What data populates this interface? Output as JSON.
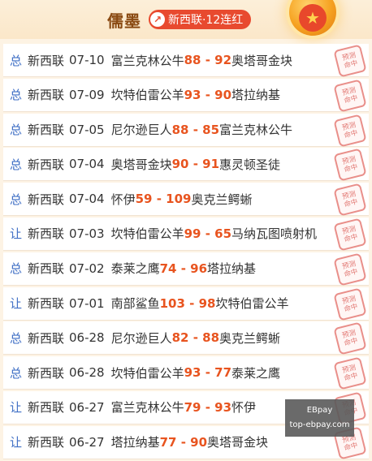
{
  "header": {
    "author_name": "儒墨",
    "streak_label": "新西联·12连红",
    "streak_icon": "upward-arrow-icon",
    "medal_icon": "gold-star-medal-icon"
  },
  "stamp_text": [
    "预测",
    "命中"
  ],
  "rows": [
    {
      "tag": "总",
      "league": "新西联",
      "date": "07-10",
      "home": "富兰克林公牛",
      "score": "88 - 92",
      "away": "奥塔哥金块"
    },
    {
      "tag": "总",
      "league": "新西联",
      "date": "07-09",
      "home": "坎特伯雷公羊",
      "score": "93 - 90",
      "away": "塔拉纳基"
    },
    {
      "tag": "总",
      "league": "新西联",
      "date": "07-05",
      "home": "尼尔逊巨人",
      "score": "88 - 85",
      "away": "富兰克林公牛"
    },
    {
      "tag": "总",
      "league": "新西联",
      "date": "07-04",
      "home": "奥塔哥金块",
      "score": "90 - 91",
      "away": "惠灵顿圣徒"
    },
    {
      "tag": "总",
      "league": "新西联",
      "date": "07-04",
      "home": "怀伊",
      "score": "59 - 109",
      "away": "奥克兰鳄蜥"
    },
    {
      "tag": "让",
      "league": "新西联",
      "date": "07-03",
      "home": "坎特伯雷公羊",
      "score": "99 - 65",
      "away": "马纳瓦图喷射机"
    },
    {
      "tag": "总",
      "league": "新西联",
      "date": "07-02",
      "home": "泰莱之鹰",
      "score": "74 - 96",
      "away": "塔拉纳基"
    },
    {
      "tag": "让",
      "league": "新西联",
      "date": "07-01",
      "home": "南部鲨鱼",
      "score": "103 - 98",
      "away": "坎特伯雷公羊"
    },
    {
      "tag": "总",
      "league": "新西联",
      "date": "06-28",
      "home": "尼尔逊巨人",
      "score": "82 - 88",
      "away": "奥克兰鳄蜥"
    },
    {
      "tag": "总",
      "league": "新西联",
      "date": "06-28",
      "home": "坎特伯雷公羊",
      "score": "93 - 77",
      "away": "泰莱之鹰"
    },
    {
      "tag": "让",
      "league": "新西联",
      "date": "06-27",
      "home": "富兰克林公牛",
      "score": "79 - 93",
      "away": "怀伊"
    },
    {
      "tag": "让",
      "league": "新西联",
      "date": "06-27",
      "home": "塔拉纳基",
      "score": "77 - 90",
      "away": "奥塔哥金块"
    }
  ],
  "watermark": {
    "line1": "EBpay",
    "line2": "top-ebpay.com"
  }
}
